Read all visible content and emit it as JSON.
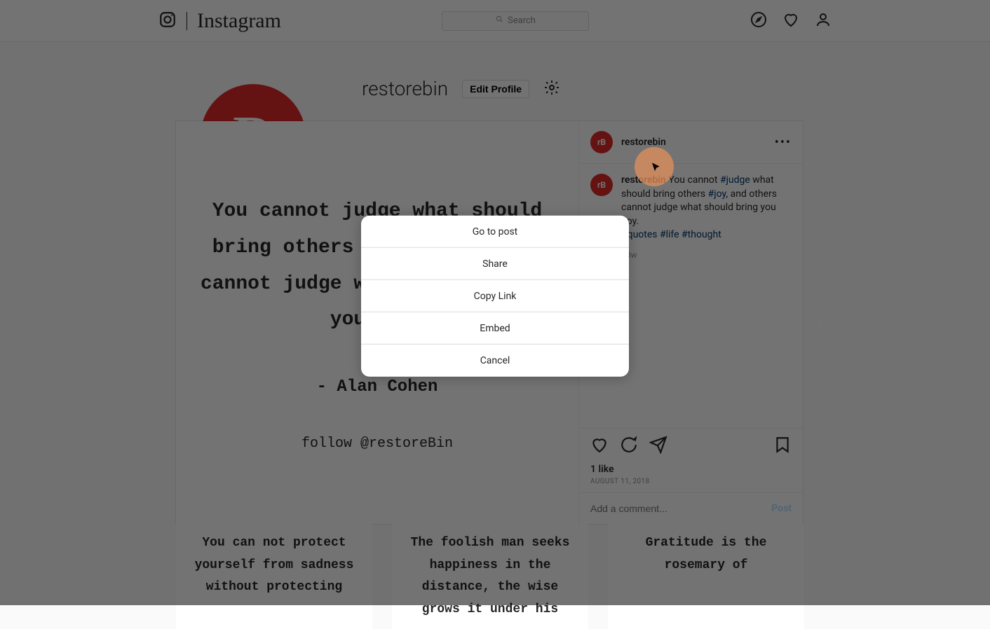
{
  "header": {
    "brand": "Instagram",
    "search_placeholder": "Search"
  },
  "profile": {
    "username": "restorebin",
    "avatar_letter": "R",
    "edit_profile": "Edit Profile"
  },
  "post": {
    "quote": "You cannot judge what should bring others joy, and others cannot judge what should bring you Joy.",
    "author": "- Alan Cohen",
    "follow": "follow @restoreBin",
    "username": "restorebin",
    "mini_avatar": "rB",
    "caption_lead": "You cannot ",
    "hash1": "#judge",
    "caption_mid": " what should bring others ",
    "hash2": "#joy",
    "caption_tail": ", and others cannot judge what should bring you Joy.",
    "hash3": "#quotes",
    "hash4": "#life",
    "hash5": "#thought",
    "time": "70w",
    "likes": "1 like",
    "date": "AUGUST 11, 2018",
    "comment_placeholder": "Add a comment...",
    "post_label": "Post"
  },
  "thumbs": [
    "You can not protect yourself from sadness without protecting",
    "The foolish man seeks happiness in the distance, the wise grows it under his",
    "Gratitude is the rosemary of"
  ],
  "dialog": {
    "items": [
      "Go to post",
      "Share",
      "Copy Link",
      "Embed",
      "Cancel"
    ]
  }
}
